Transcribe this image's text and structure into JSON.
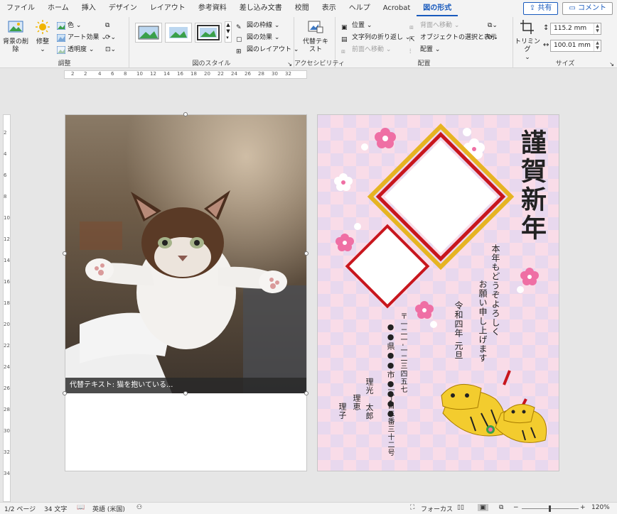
{
  "tabs": [
    "ファイル",
    "ホーム",
    "挿入",
    "デザイン",
    "レイアウト",
    "参考資料",
    "差し込み文書",
    "校閲",
    "表示",
    "ヘルプ",
    "Acrobat",
    "図の形式"
  ],
  "active_tab": "図の形式",
  "share_label": "共有",
  "comment_label": "コメント",
  "groups": {
    "adjust": {
      "label": "調整",
      "remove_bg": "背景の削除",
      "correct": "修整",
      "color": "色",
      "art_effects": "アート効果",
      "transparency": "透明度"
    },
    "styles": {
      "label": "図のスタイル",
      "border": "図の枠線",
      "effects": "図の効果",
      "layout": "図のレイアウト"
    },
    "accessibility": {
      "label": "アクセシビリティ",
      "alt_text": "代替テキスト"
    },
    "arrange": {
      "label": "配置",
      "position": "位置",
      "wrap": "文字列の折り返し",
      "forward": "前面へ移動",
      "backward": "背面へ移動",
      "select_pane": "オブジェクトの選択と表示",
      "align": "配置"
    },
    "size": {
      "label": "サイズ",
      "crop": "トリミング",
      "height": "115.2 mm",
      "width": "100.01 mm"
    }
  },
  "ruler_h": [
    "2",
    "2",
    "4",
    "6",
    "8",
    "10",
    "12",
    "14",
    "16",
    "18",
    "20",
    "22",
    "24",
    "26",
    "28",
    "30",
    "32"
  ],
  "ruler_v": [
    "2",
    "4",
    "6",
    "8",
    "10",
    "12",
    "14",
    "16",
    "18",
    "20",
    "22",
    "24",
    "26",
    "28",
    "30",
    "32",
    "34"
  ],
  "alt_text_caption": "代替テキスト: 猫を抱いている...",
  "card": {
    "greeting": "謹賀新年",
    "message_1": "本年もどうぞよろしく",
    "message_2": "お願い申し上げます",
    "date": "令和四年 元旦",
    "postal": "〒一二一-一二三四五七",
    "address_1": "●●県●●市●●●●",
    "address_2": "一丁目二番三十二号",
    "name_1": "理光　太郎",
    "name_2": "理恵",
    "name_3": "理子"
  },
  "status": {
    "page": "1/2 ページ",
    "words": "34 文字",
    "language": "英語 (米国)",
    "focus": "フォーカス",
    "zoom": "120%",
    "minus": "−",
    "plus": "+"
  },
  "colors": {
    "accent": "#185abd",
    "check_pink": "#f9dce8",
    "check_lavender": "#e8d8ee",
    "gold": "#e6b422",
    "red": "#c8161d"
  }
}
